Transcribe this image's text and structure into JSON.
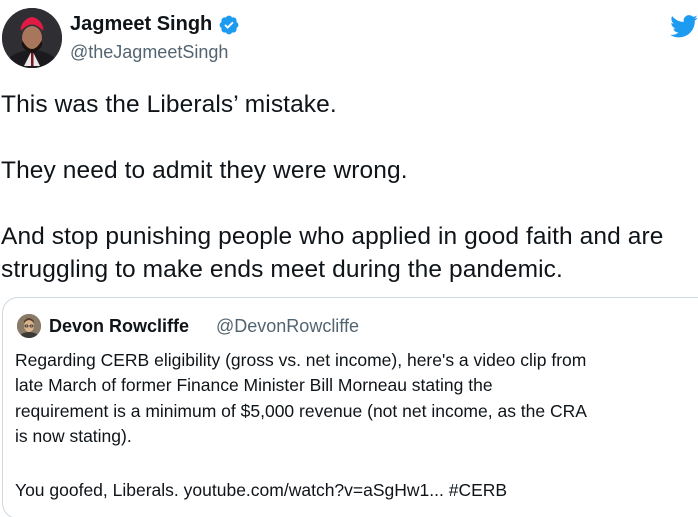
{
  "tweet": {
    "author": {
      "name": "Jagmeet Singh",
      "handle": "@theJagmeetSingh",
      "verified_icon": "verified-badge-icon",
      "avatar_icon": "profile-avatar"
    },
    "logo_icon": "twitter-bird-icon",
    "text_lines": [
      "This was the Liberals’ mistake.",
      "They need to admit they were wrong.",
      "And stop punishing people who applied in good faith and are",
      "struggling to make ends meet during the pandemic."
    ],
    "quoted": {
      "author": {
        "name": "Devon Rowcliffe",
        "handle": "@DevonRowcliffe",
        "avatar_icon": "profile-avatar"
      },
      "text_lines": [
        "Regarding CERB eligibility (gross vs. net income), here's a video clip from",
        "late March of former Finance Minister Bill Morneau stating the",
        "requirement is a minimum of $5,000 revenue (not net income, as the CRA",
        "is now stating).",
        "You goofed, Liberals. youtube.com/watch?v=aSgHw1... #CERB"
      ]
    }
  },
  "colors": {
    "text": "#0f1419",
    "secondary": "#536471",
    "twitter_blue": "#1d9bf0",
    "border": "#cfd9de"
  }
}
